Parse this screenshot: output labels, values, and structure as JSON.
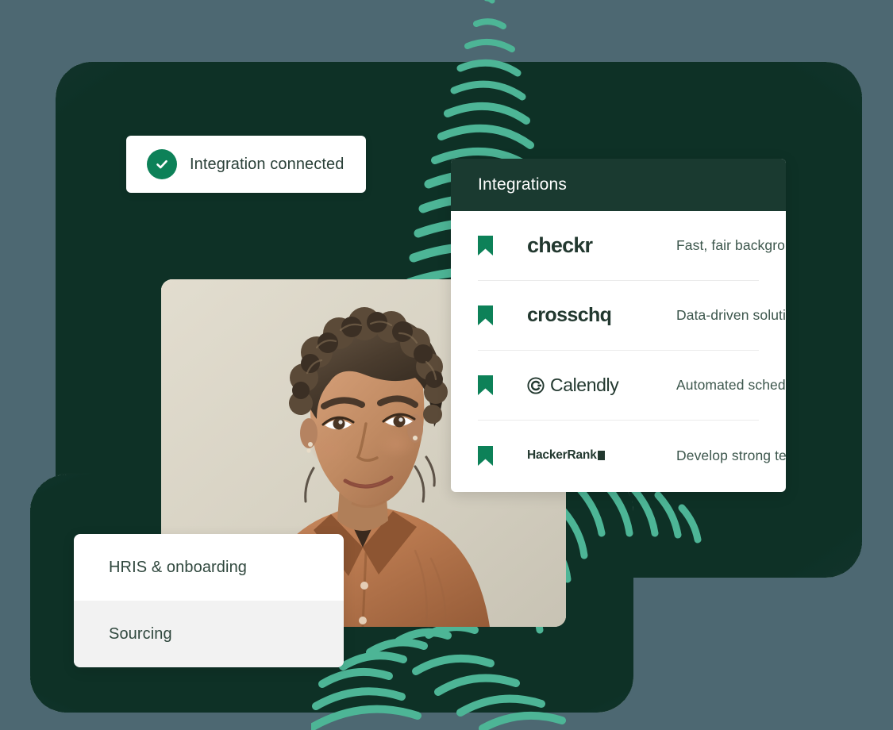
{
  "theme": {
    "page_background": "#4d6872",
    "dark_green": "#1a3a30",
    "accent_green": "#0d8158",
    "fingerprint_green": "#4db596",
    "card_white": "#ffffff",
    "menu_alt_row": "#f2f2f2",
    "text_dark": "#2a4038",
    "text_muted": "#3c564c"
  },
  "toast": {
    "icon": "check-circle-icon",
    "message": "Integration connected"
  },
  "integrations_card": {
    "header_title": "Integrations",
    "rows": [
      {
        "bookmark_icon": "bookmark-icon",
        "logo_name": "checkr",
        "logo_text": "checkr",
        "description": "Fast, fair backgroun…"
      },
      {
        "bookmark_icon": "bookmark-icon",
        "logo_name": "crosschq",
        "logo_text": "crosschq",
        "description": "Data-driven solutio…"
      },
      {
        "bookmark_icon": "bookmark-icon",
        "logo_name": "calendly",
        "logo_text": "Calendly",
        "description": "Automated scheduli…"
      },
      {
        "bookmark_icon": "bookmark-icon",
        "logo_name": "hackerrank",
        "logo_text": "HackerRank",
        "description": "Develop strong tech.."
      }
    ]
  },
  "menu_card": {
    "items": [
      {
        "label": "HRIS & onboarding"
      },
      {
        "label": "Sourcing"
      }
    ]
  },
  "decoration": {
    "fingerprint_top": "fingerprint-graphic",
    "fingerprint_bottom": "fingerprint-graphic",
    "photo": "portrait-photo-woman-smiling"
  }
}
